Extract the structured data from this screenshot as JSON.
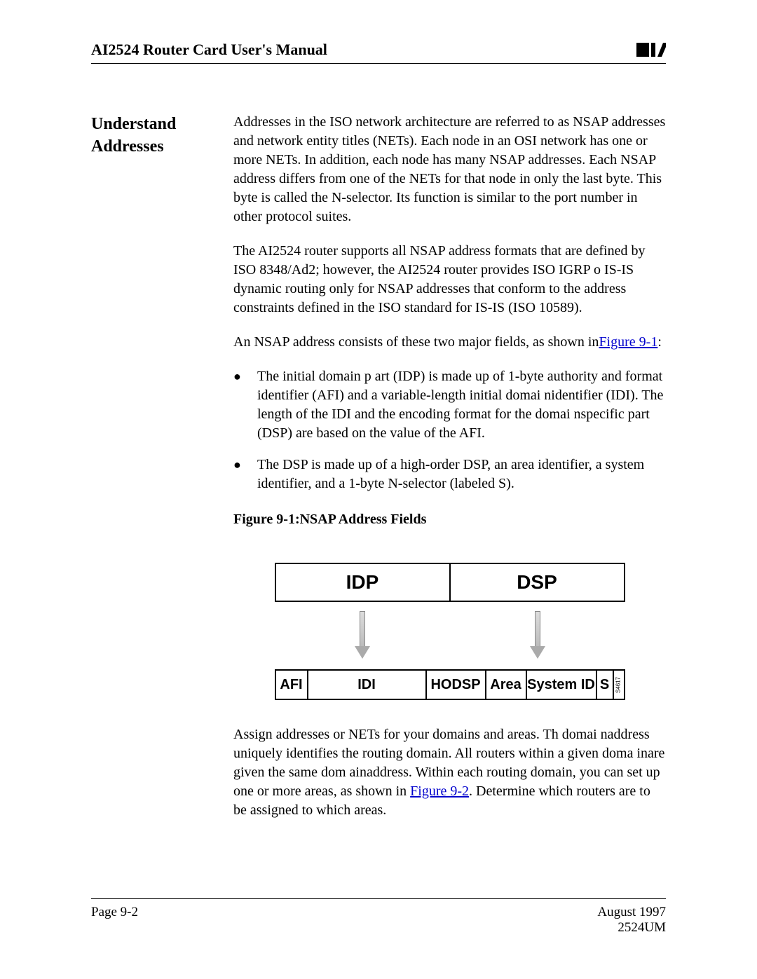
{
  "header": {
    "title": "AI2524 Router Card User's Manual",
    "logo_name": "ai-logo"
  },
  "section": {
    "heading": "Understand Addresses"
  },
  "body": {
    "p1": "Addresses in the ISO network architecture are referred to as NSAP addresses and network entity titles (NETs). Each node in an OSI network has one or more NETs. In addition, each node has many NSAP addresses. Each NSAP address differs from one of the NETs for that node in only the last byte. This byte is called the N-selector. Its function is similar to the port number in other protocol suites.",
    "p2": "The AI2524 router supports all NSAP address formats that are defined by ISO 8348/Ad2; however, the AI2524 router provides ISO IGRP o IS-IS dynamic routing only for NSAP addresses that conform to the address constraints defined in the ISO standard for IS-IS (ISO 10589).",
    "p3_text": "An NSAP address consists of these two major fields, as shown in",
    "p3_link": "Figure 9-1",
    "p3_suffix": ":",
    "bullets": [
      "The initial domain p art (IDP) is made up of 1-byte authority and format identifier (AFI) and a variable-length initial domai nidentifier (IDI). The length of the IDI and the encoding format for the domai nspecific part (DSP) are based on the value of the AFI.",
      "The DSP is made up of a high-order DSP, an area identifier, a system identifier, and a 1-byte N-selector (labeled S)."
    ],
    "figure_caption": "Figure 9-1:NSAP Address Fields",
    "p4_text": "Assign addresses or NETs for your domains and areas. Th domai naddress uniquely identifies the routing domain. All routers within a given doma inare given the same dom ainaddress. Within each routing domain, you can set up one or more areas, as shown in ",
    "p4_link": "Figure 9-2",
    "p4_suffix": ". Determine which routers are to be assigned to which areas."
  },
  "chart_data": {
    "type": "table",
    "description": "NSAP Address Fields diagram",
    "top_row": [
      "IDP",
      "DSP"
    ],
    "bottom_row": [
      "AFI",
      "IDI",
      "HODSP",
      "Area",
      "System ID",
      "S"
    ],
    "side_code": "S4617",
    "mapping": {
      "IDP": [
        "AFI",
        "IDI"
      ],
      "DSP": [
        "HODSP",
        "Area",
        "System ID",
        "S"
      ]
    }
  },
  "footer": {
    "page": "Page 9-2",
    "date": "August 1997",
    "docnum": "2524UM"
  }
}
